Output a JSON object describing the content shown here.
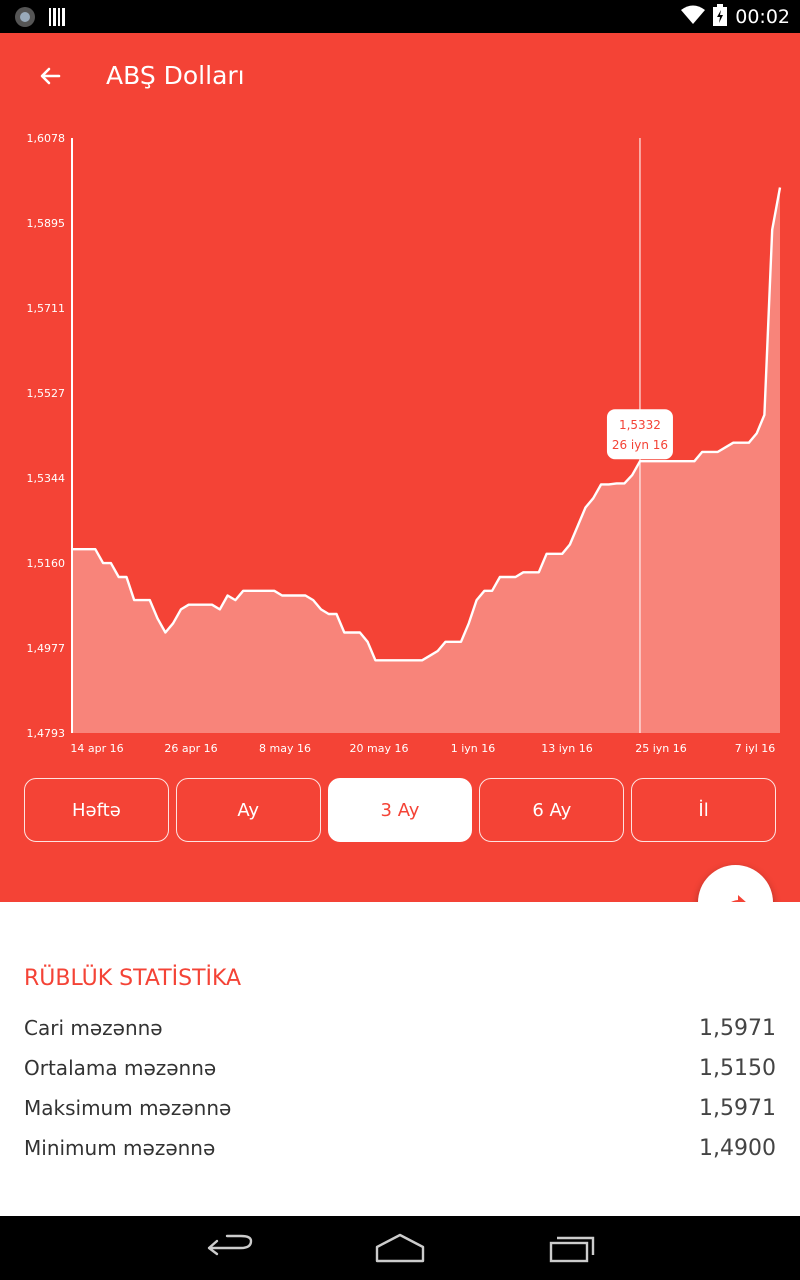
{
  "status_bar": {
    "time": "00:02"
  },
  "app_bar": {
    "title": "ABŞ Dolları"
  },
  "chart_data": {
    "type": "area",
    "ylim": [
      1.4793,
      1.6078
    ],
    "y_ticks": [
      "1,6078",
      "1,5895",
      "1,5711",
      "1,5527",
      "1,5344",
      "1,5160",
      "1,4977",
      "1,4793"
    ],
    "x_ticks": [
      "14 apr 16",
      "26 apr 16",
      "8 may 16",
      "20 may 16",
      "1 iyn 16",
      "13 iyn 16",
      "25 iyn 16",
      "7 iyl 16"
    ],
    "x": [
      "2016-04-14",
      "2016-04-15",
      "2016-04-16",
      "2016-04-17",
      "2016-04-18",
      "2016-04-19",
      "2016-04-20",
      "2016-04-21",
      "2016-04-22",
      "2016-04-23",
      "2016-04-24",
      "2016-04-25",
      "2016-04-26",
      "2016-04-27",
      "2016-04-28",
      "2016-04-29",
      "2016-04-30",
      "2016-05-01",
      "2016-05-02",
      "2016-05-03",
      "2016-05-04",
      "2016-05-05",
      "2016-05-06",
      "2016-05-07",
      "2016-05-08",
      "2016-05-09",
      "2016-05-10",
      "2016-05-11",
      "2016-05-12",
      "2016-05-13",
      "2016-05-14",
      "2016-05-15",
      "2016-05-16",
      "2016-05-17",
      "2016-05-18",
      "2016-05-19",
      "2016-05-20",
      "2016-05-21",
      "2016-05-22",
      "2016-05-23",
      "2016-05-24",
      "2016-05-25",
      "2016-05-26",
      "2016-05-27",
      "2016-05-28",
      "2016-05-29",
      "2016-05-30",
      "2016-05-31",
      "2016-06-01",
      "2016-06-02",
      "2016-06-03",
      "2016-06-04",
      "2016-06-05",
      "2016-06-06",
      "2016-06-07",
      "2016-06-08",
      "2016-06-09",
      "2016-06-10",
      "2016-06-11",
      "2016-06-12",
      "2016-06-13",
      "2016-06-14",
      "2016-06-15",
      "2016-06-16",
      "2016-06-17",
      "2016-06-18",
      "2016-06-19",
      "2016-06-20",
      "2016-06-21",
      "2016-06-22",
      "2016-06-23",
      "2016-06-24",
      "2016-06-25",
      "2016-06-26",
      "2016-06-27",
      "2016-06-28",
      "2016-06-29",
      "2016-06-30",
      "2016-07-01",
      "2016-07-02",
      "2016-07-03",
      "2016-07-04",
      "2016-07-05",
      "2016-07-06",
      "2016-07-07",
      "2016-07-08",
      "2016-07-09",
      "2016-07-10",
      "2016-07-11",
      "2016-07-12",
      "2016-07-13",
      "2016-07-14"
    ],
    "values": [
      1.519,
      1.519,
      1.519,
      1.519,
      1.516,
      1.516,
      1.513,
      1.513,
      1.508,
      1.508,
      1.508,
      1.504,
      1.501,
      1.503,
      1.506,
      1.507,
      1.507,
      1.507,
      1.507,
      1.506,
      1.509,
      1.508,
      1.51,
      1.51,
      1.51,
      1.51,
      1.51,
      1.509,
      1.509,
      1.509,
      1.509,
      1.508,
      1.506,
      1.505,
      1.505,
      1.501,
      1.501,
      1.501,
      1.499,
      1.495,
      1.495,
      1.495,
      1.495,
      1.495,
      1.495,
      1.495,
      1.496,
      1.497,
      1.499,
      1.499,
      1.499,
      1.503,
      1.508,
      1.51,
      1.51,
      1.513,
      1.513,
      1.513,
      1.514,
      1.514,
      1.514,
      1.518,
      1.518,
      1.518,
      1.52,
      1.524,
      1.528,
      1.53,
      1.533,
      1.533,
      1.5332,
      1.5332,
      1.535,
      1.538,
      1.538,
      1.538,
      1.538,
      1.538,
      1.538,
      1.538,
      1.538,
      1.54,
      1.54,
      1.54,
      1.541,
      1.542,
      1.542,
      1.542,
      1.544,
      1.548,
      1.588,
      1.5971
    ],
    "highlight": {
      "value": "1,5332",
      "date": "26 iyn 16",
      "index": 73
    }
  },
  "periods": {
    "week": "Həftə",
    "month": "Ay",
    "three_months": "3 Ay",
    "six_months": "6 Ay",
    "year": "İl"
  },
  "stats": {
    "title": "RÜBLÜK STATİSTİKA",
    "current_label": "Cari məzənnə",
    "current_value": "1,5971",
    "avg_label": "Ortalama məzənnə",
    "avg_value": "1,5150",
    "max_label": "Maksimum məzənnə",
    "max_value": "1,5971",
    "min_label": "Minimum məzənnə",
    "min_value": "1,4900"
  },
  "colors": {
    "accent": "#f44336",
    "fill": "#f8847a"
  }
}
